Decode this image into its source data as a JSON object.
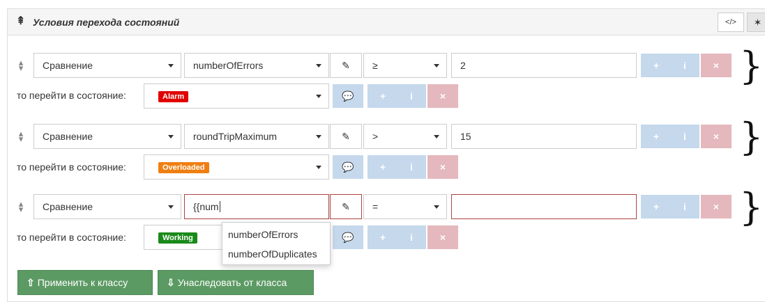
{
  "header": {
    "title": "Условия перехода состояний",
    "icon": "sliders-icon",
    "code_btn": "</>",
    "pin_btn": "pin-icon"
  },
  "rules": [
    {
      "condition_type": "Сравнение",
      "field": "numberOfErrors",
      "operator": "≥",
      "value": "2",
      "goto_label": "то перейти в состояние:",
      "state": "Alarm",
      "state_color": "#e00000"
    },
    {
      "condition_type": "Сравнение",
      "field": "roundTripMaximum",
      "operator": ">",
      "value": "15",
      "goto_label": "то перейти в состояние:",
      "state": "Overloaded",
      "state_color": "#f07f12"
    },
    {
      "condition_type": "Сравнение",
      "field": "{{num",
      "operator": "=",
      "value": "",
      "goto_label": "то перейти в состояние:",
      "state": "Working",
      "state_color": "#1a8a1a"
    }
  ],
  "autocomplete": {
    "options": [
      "numberOfErrors",
      "numberOfDuplicates"
    ]
  },
  "actions": {
    "apply": "Применить к классу",
    "inherit": "Унаследовать от класса"
  },
  "colors": {
    "accent_green": "#5c9a64",
    "btn_blue": "#c5d8ec",
    "btn_red": "#e4b8bd",
    "error_border": "#a94442"
  }
}
